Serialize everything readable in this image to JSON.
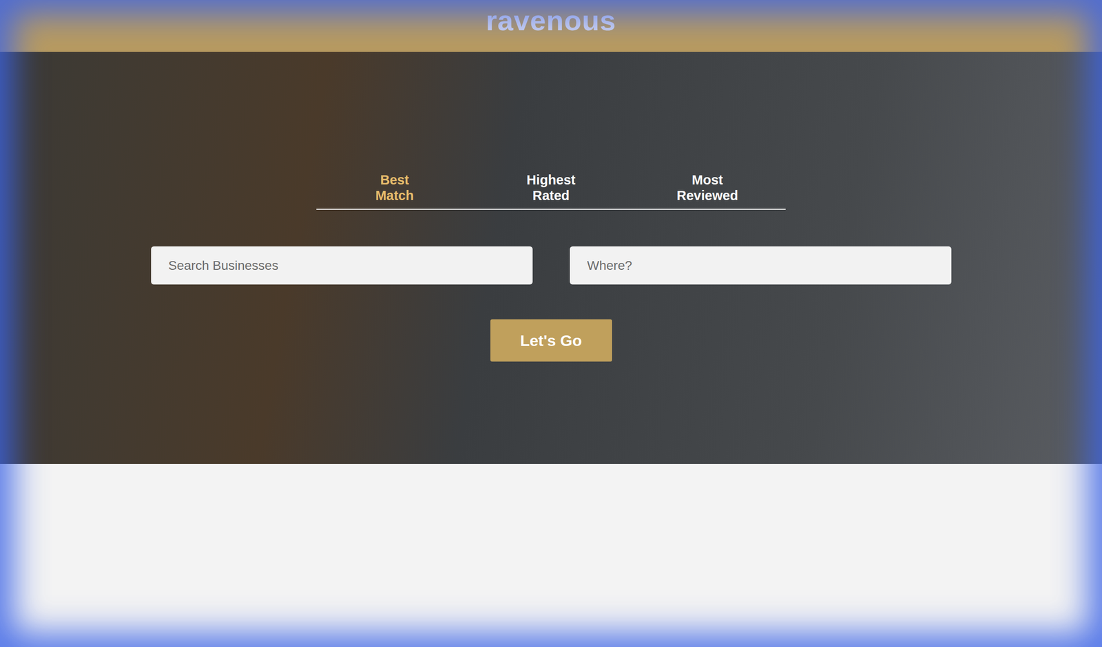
{
  "logo": "ravenous",
  "tabs": [
    {
      "label": "Best Match",
      "selected": true
    },
    {
      "label": "Highest Rated",
      "selected": false
    },
    {
      "label": "Most Reviewed",
      "selected": false
    }
  ],
  "search": {
    "business_placeholder": "Search Businesses",
    "location_placeholder": "Where?"
  },
  "submit_button": "Let's Go"
}
